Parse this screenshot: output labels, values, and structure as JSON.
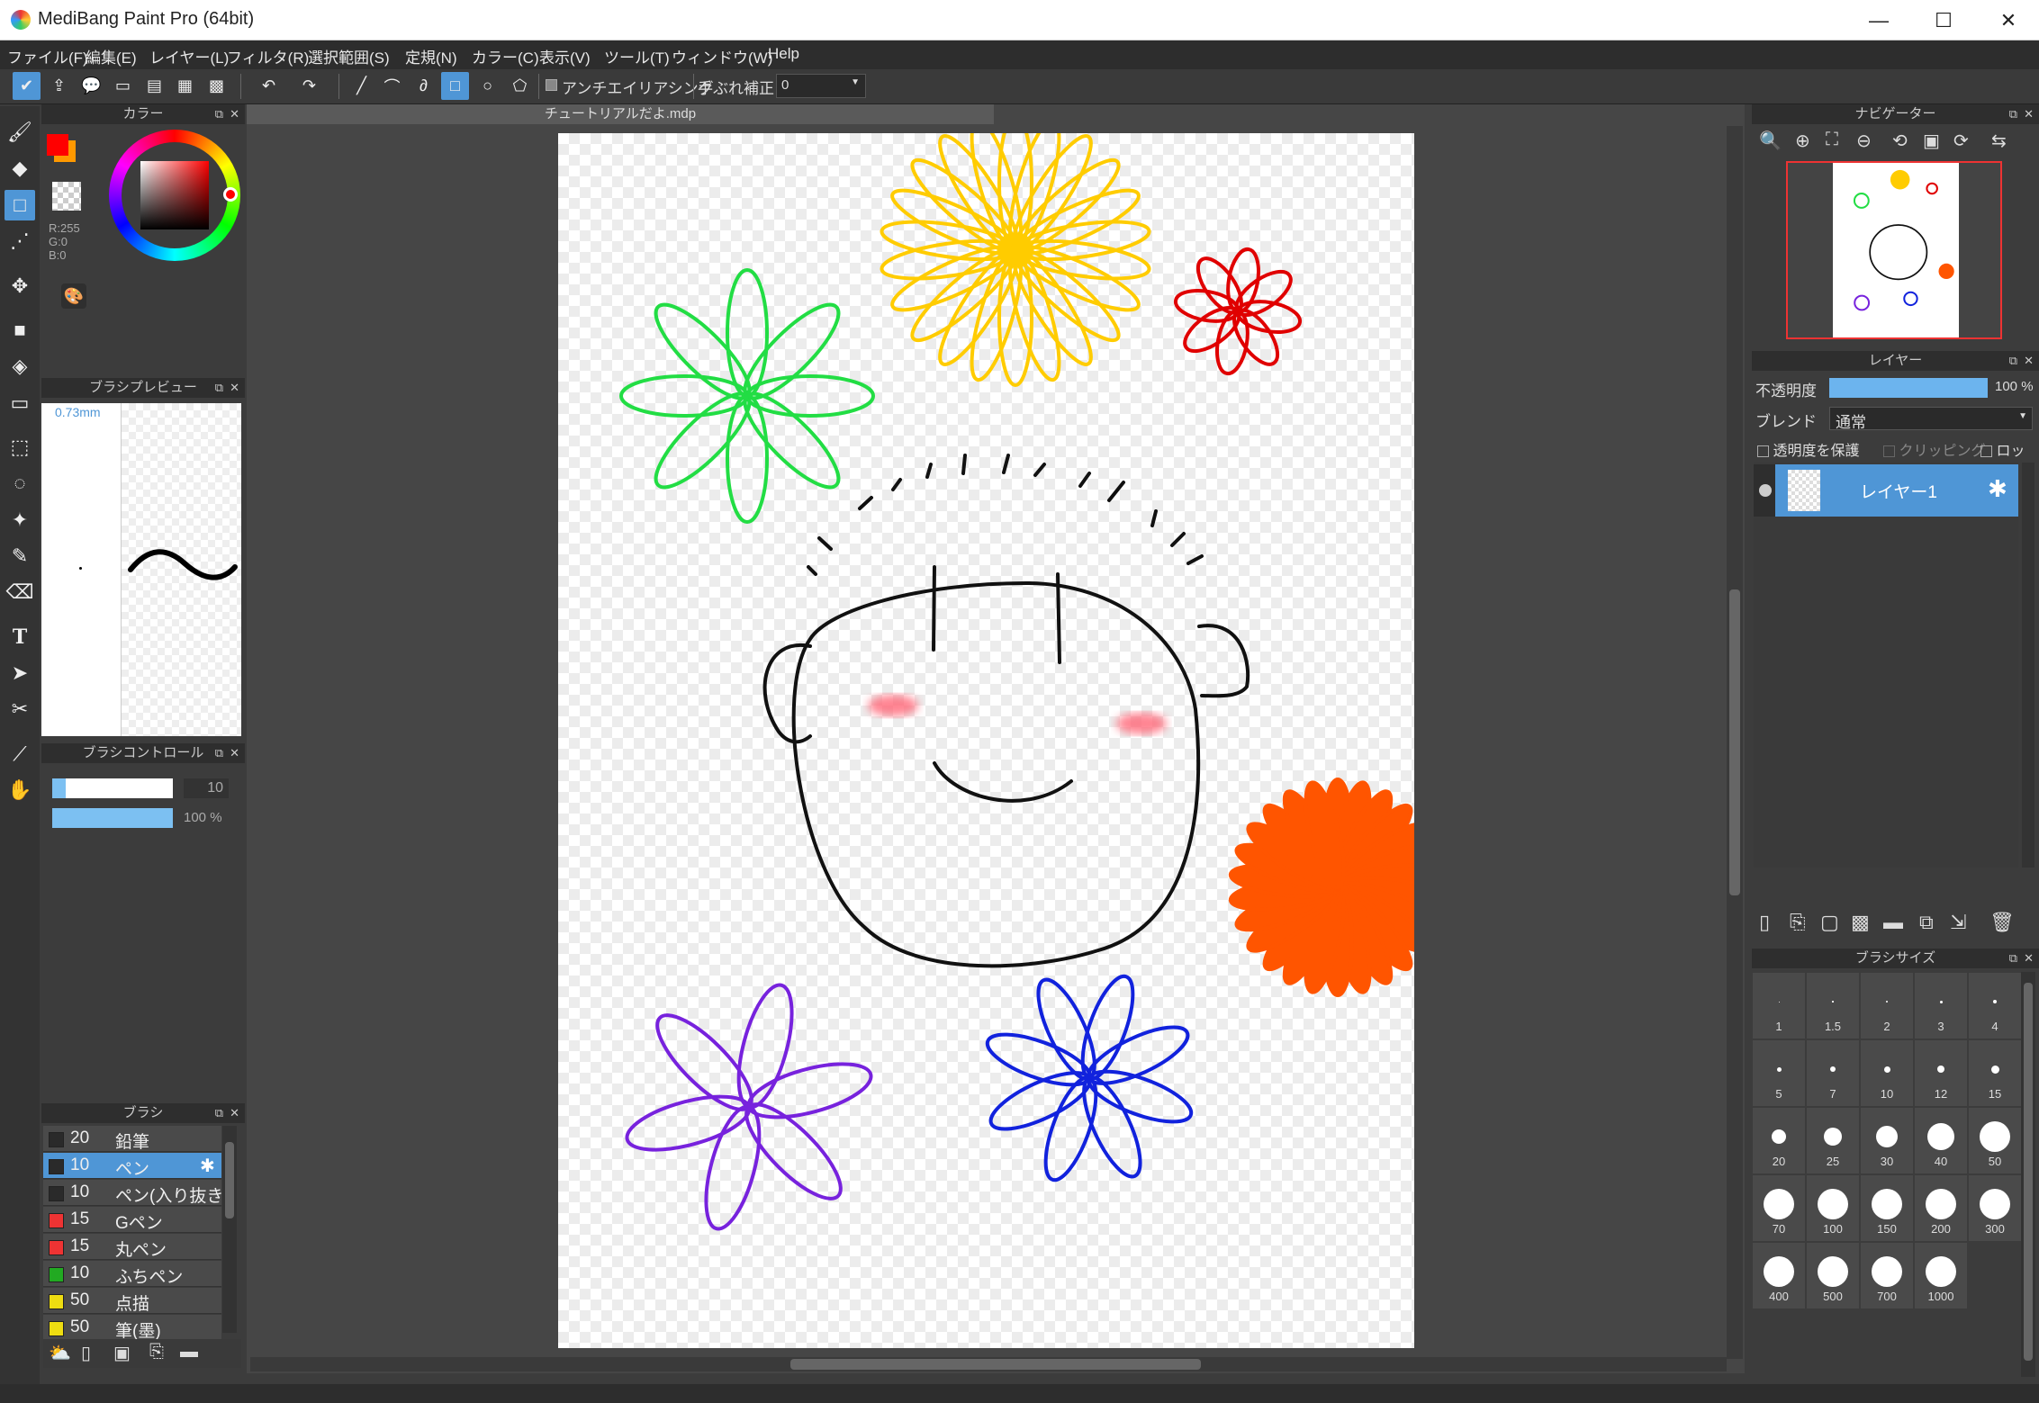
{
  "window": {
    "title": "MediBang Paint Pro (64bit)",
    "minimize": "—",
    "maximize": "☐",
    "close": "✕"
  },
  "menu": [
    "ファイル(F)",
    "編集(E)",
    "レイヤー(L)",
    "フィルタ(R)",
    "選択範囲(S)",
    "定規(N)",
    "カラー(C)",
    "表示(V)",
    "ツール(T)",
    "ウィンドウ(W)",
    "Help"
  ],
  "toolbar": {
    "antialias_label": "アンチエイリアシング",
    "stabilizer_label": "手ぶれ補正",
    "stabilizer_value": "0"
  },
  "color_panel": {
    "title": "カラー",
    "primary_color": "#ff0000",
    "secondary_color": "#ff9900",
    "r": "R:255",
    "g": "G:0",
    "b": "B:0"
  },
  "brush_preview": {
    "title": "ブラシプレビュー",
    "size_text": "0.73mm"
  },
  "brush_control": {
    "title": "ブラシコントロール",
    "size_value": "10",
    "size_fraction": 0.11,
    "opacity_value": "100 %",
    "opacity_fraction": 1.0
  },
  "brush_panel": {
    "title": "ブラシ",
    "items": [
      {
        "size": "20",
        "name": "鉛筆",
        "color": "#2a2a2a",
        "selected": false
      },
      {
        "size": "10",
        "name": "ペン",
        "color": "#2a2a2a",
        "selected": true
      },
      {
        "size": "10",
        "name": "ペン(入り抜き)",
        "color": "#2a2a2a",
        "selected": false
      },
      {
        "size": "15",
        "name": "Gペン",
        "color": "#ee3333",
        "selected": false
      },
      {
        "size": "15",
        "name": "丸ペン",
        "color": "#ee3333",
        "selected": false
      },
      {
        "size": "10",
        "name": "ふちペン",
        "color": "#22aa22",
        "selected": false
      },
      {
        "size": "50",
        "name": "点描",
        "color": "#eedd11",
        "selected": false
      },
      {
        "size": "50",
        "name": "筆(墨)",
        "color": "#eedd11",
        "selected": false
      }
    ]
  },
  "document": {
    "tab_title": "チュートリアルだよ.mdp"
  },
  "navigator": {
    "title": "ナビゲーター"
  },
  "layer_panel": {
    "title": "レイヤー",
    "opacity_label": "不透明度",
    "opacity_value": "100 %",
    "opacity_fraction": 1.0,
    "blend_label": "ブレンド",
    "blend_value": "通常",
    "protect_alpha": "透明度を保護",
    "clipping": "クリッピング",
    "lock": "ロック",
    "layers": [
      {
        "name": "レイヤー1",
        "selected": true
      }
    ]
  },
  "brush_size_panel": {
    "title": "ブラシサイズ",
    "sizes": [
      "1",
      "1.5",
      "2",
      "3",
      "4",
      "5",
      "7",
      "10",
      "12",
      "15",
      "20",
      "25",
      "30",
      "40",
      "50",
      "70",
      "100",
      "150",
      "200",
      "300",
      "400",
      "500",
      "700",
      "1000"
    ]
  }
}
